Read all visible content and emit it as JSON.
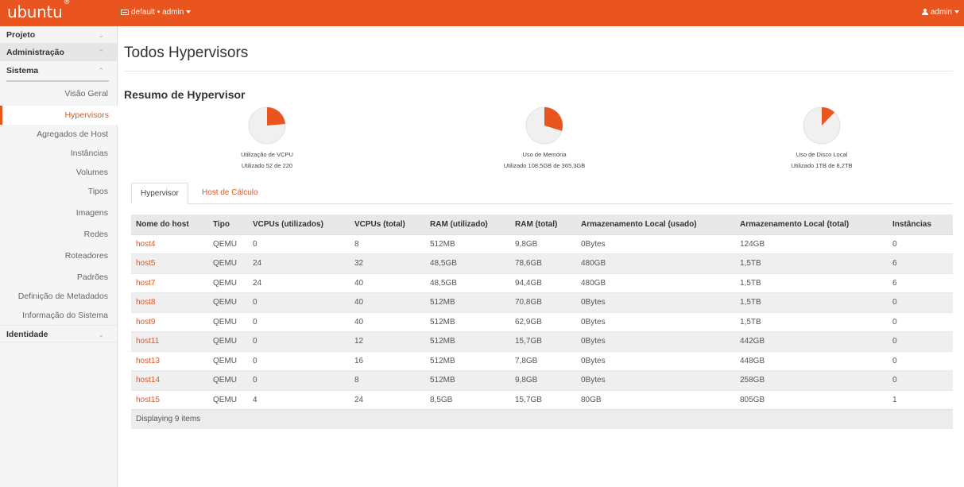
{
  "topbar": {
    "brand": "ubuntu",
    "brand_mark": "®",
    "project_selector": "default • admin",
    "user": "admin"
  },
  "sidebar": {
    "projeto": "Projeto",
    "administracao": "Administração",
    "sistema": "Sistema",
    "items": [
      "Visão Geral",
      "Hypervisors",
      "Agregados de Host",
      "Instâncias",
      "Volumes",
      "Tipos",
      "Imagens",
      "Redes",
      "Roteadores",
      "Padrões",
      "Definição de Metadados",
      "Informação do Sistema"
    ],
    "identidade": "Identidade"
  },
  "page": {
    "title": "Todos Hypervisors",
    "summary_title": "Resumo de Hypervisor"
  },
  "summary": [
    {
      "label": "Utilização de VCPU",
      "detail": "Utilizado 52 de 220",
      "used": 52,
      "total": 220
    },
    {
      "label": "Uso de Memória",
      "detail": "Utilizado 108,5GB de 365,3GB",
      "used": 108.5,
      "total": 365.3
    },
    {
      "label": "Uso de Disco Local",
      "detail": "Utilizado 1TB de 8,2TB",
      "used": 1,
      "total": 8.2
    }
  ],
  "tabs": {
    "active": "Hypervisor",
    "other": "Host de Cálculo"
  },
  "table": {
    "columns": [
      "Nome do host",
      "Tipo",
      "VCPUs (utilizados)",
      "VCPUs (total)",
      "RAM (utilizado)",
      "RAM (total)",
      "Armazenamento Local (usado)",
      "Armazenamento Local (total)",
      "Instâncias"
    ],
    "rows": [
      [
        "host4",
        "QEMU",
        "0",
        "8",
        "512MB",
        "9,8GB",
        "0Bytes",
        "124GB",
        "0"
      ],
      [
        "host5",
        "QEMU",
        "24",
        "32",
        "48,5GB",
        "78,6GB",
        "480GB",
        "1,5TB",
        "6"
      ],
      [
        "host7",
        "QEMU",
        "24",
        "40",
        "48,5GB",
        "94,4GB",
        "480GB",
        "1,5TB",
        "6"
      ],
      [
        "host8",
        "QEMU",
        "0",
        "40",
        "512MB",
        "70,8GB",
        "0Bytes",
        "1,5TB",
        "0"
      ],
      [
        "host9",
        "QEMU",
        "0",
        "40",
        "512MB",
        "62,9GB",
        "0Bytes",
        "1,5TB",
        "0"
      ],
      [
        "host11",
        "QEMU",
        "0",
        "12",
        "512MB",
        "15,7GB",
        "0Bytes",
        "442GB",
        "0"
      ],
      [
        "host13",
        "QEMU",
        "0",
        "16",
        "512MB",
        "7,8GB",
        "0Bytes",
        "448GB",
        "0"
      ],
      [
        "host14",
        "QEMU",
        "0",
        "8",
        "512MB",
        "9,8GB",
        "0Bytes",
        "258GB",
        "0"
      ],
      [
        "host15",
        "QEMU",
        "4",
        "24",
        "8,5GB",
        "15,7GB",
        "80GB",
        "805GB",
        "1"
      ]
    ],
    "footer": "Displaying 9 items"
  },
  "colors": {
    "accent": "#e9541f",
    "pie_bg": "#f0f0f0"
  }
}
